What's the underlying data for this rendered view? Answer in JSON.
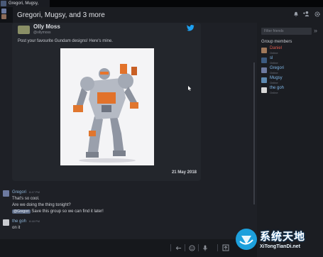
{
  "tab": {
    "label": "Gregori, Mugsy,"
  },
  "header": {
    "title": "Gregori, Mugsy, and 3 more"
  },
  "embed": {
    "name": "Olly Moss",
    "handle": "@ollymoss",
    "text": "Post your favourite Gundam designs! Here's mine.",
    "date": "21 May 2018"
  },
  "messages": [
    {
      "name": "Gregori",
      "time": "8:47 PM",
      "lines": [
        "That's so cool.",
        "Are we doing the thing tonight?"
      ],
      "mention": "@Gregori",
      "mention_rest": "Save this group so we can find it later!"
    },
    {
      "name": "the goh",
      "time": "8:48 PM",
      "lines": [
        "on it"
      ]
    }
  ],
  "members_panel": {
    "search_placeholder": "Filter friends",
    "title": "Group members",
    "members": [
      {
        "name": "Daniel",
        "status": "Online",
        "color": "#e05a4e"
      },
      {
        "name": "sl",
        "status": "Online",
        "color": "#7fb7e8"
      },
      {
        "name": "Gregori",
        "status": "Online",
        "color": "#7fb7e8"
      },
      {
        "name": "Mugsy",
        "status": "Online",
        "color": "#7fb7e8"
      },
      {
        "name": "the goh",
        "status": "Online",
        "color": "#7fb7e8"
      }
    ]
  },
  "watermark": {
    "title": "系统天地",
    "url": "XiTongTianDi.net"
  }
}
